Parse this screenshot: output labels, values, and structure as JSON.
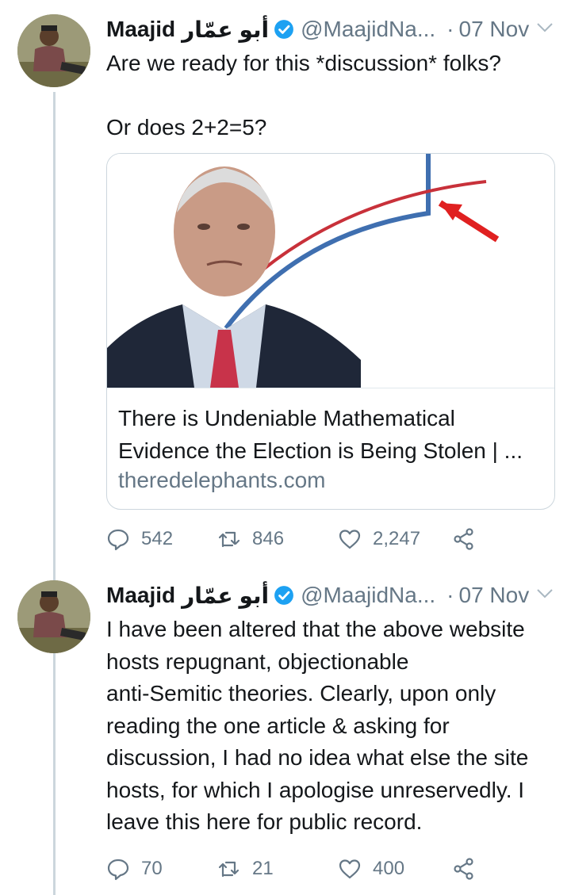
{
  "tweets": [
    {
      "name": "Maajid",
      "arabic_name": "أبو عمّار",
      "handle": "@MaajidNa...",
      "separator": "·",
      "date": "07 Nov",
      "text_lines": [
        "Are we ready for this *discussion* folks?",
        "",
        "Or does 2+2=5?"
      ],
      "card": {
        "title": "There is Undeniable Mathematical Evidence the Election is Being Stolen | ...",
        "domain": "theredelephants.com"
      },
      "counts": {
        "replies": "542",
        "retweets": "846",
        "likes": "2,247"
      }
    },
    {
      "name": "Maajid",
      "arabic_name": "أبو عمّار",
      "handle": "@MaajidNa...",
      "separator": "·",
      "date": "07 Nov",
      "text_lines": [
        "I have been altered that the above website",
        "hosts repugnant, objectionable",
        "anti-Semitic theories. Clearly, upon only",
        "reading the one article & asking for",
        "discussion, I had no idea what else the site",
        "hosts, for which I apologise unreservedly. I",
        "leave this here for public record."
      ],
      "counts": {
        "replies": "70",
        "retweets": "21",
        "likes": "400"
      }
    }
  ],
  "colors": {
    "verified": "#1da1f2",
    "muted": "#657786",
    "thread_line": "#ccd6dd"
  },
  "icons": [
    "verified-badge-icon",
    "chevron-down-icon",
    "reply-icon",
    "retweet-icon",
    "like-icon",
    "share-icon"
  ]
}
